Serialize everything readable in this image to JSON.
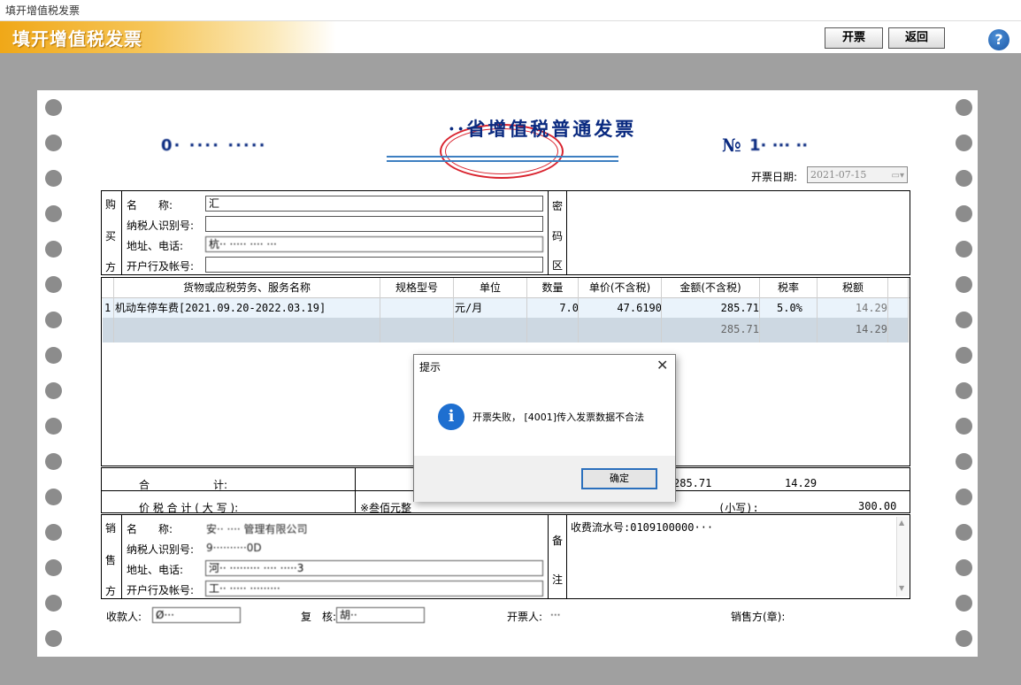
{
  "window": {
    "title": "填开增值税发票"
  },
  "header": {
    "title": "填开增值税发票",
    "issue_button": "开票",
    "back_button": "返回",
    "help_glyph": "?"
  },
  "invoice": {
    "title": "··省增值税普通发票",
    "code": "0· ···· ·····",
    "number_label": "№",
    "number": "1· ··· ··",
    "date_label": "开票日期:",
    "date": "2021-07-15",
    "buyer": {
      "side_label": [
        "购",
        "买",
        "方"
      ],
      "name_label": "名　　称:",
      "name": "汇",
      "taxid_label": "纳税人识别号:",
      "taxid": "",
      "address_label": "地址、电话:",
      "address": "杭·· ····· ···· ···",
      "bank_label": "开户行及帐号:",
      "bank": ""
    },
    "cipher_label": [
      "密",
      "码",
      "区"
    ],
    "columns": [
      "货物或应税劳务、服务名称",
      "规格型号",
      "单位",
      "数量",
      "单价(不含税)",
      "金额(不含税)",
      "税率",
      "税额"
    ],
    "items": [
      {
        "index": "1",
        "name": "机动车停车费[2021.09.20-2022.03.19]",
        "spec": "",
        "unit": "元/月",
        "qty": "7.0",
        "price": "47.6190",
        "amount": "285.71",
        "rate": "5.0%",
        "tax": "14.29"
      }
    ],
    "subtotal_row": {
      "amount": "285.71",
      "tax": "14.29"
    },
    "total_label": "合　　　　　　计:",
    "total_amount": "285.71",
    "total_tax": "14.29",
    "grand_label": "价 税 合 计 ( 大 写 ):",
    "grand_upper": "※叁佰元整",
    "grand_lower_label": "(小写):",
    "grand_lower": "300.00",
    "seller": {
      "side_label": [
        "销",
        "售",
        "方"
      ],
      "name_label": "名　　称:",
      "name": "安·· ···· 管理有限公司",
      "taxid_label": "纳税人识别号:",
      "taxid": "9··········0D",
      "address_label": "地址、电话:",
      "address": "河·· ········· ···· ·····3",
      "bank_label": "开户行及帐号:",
      "bank": "工·· ····· ·········"
    },
    "remark_label": [
      "备",
      "注"
    ],
    "remark": "收费流水号:0109100000···",
    "payee_label": "收款人:",
    "payee": "Ø···",
    "reviewer_label": "复　核:",
    "reviewer": "胡··",
    "drawer_label": "开票人:",
    "drawer": "···",
    "seller_stamp_label": "销售方(章):"
  },
  "dialog": {
    "title": "提示",
    "close_glyph": "✕",
    "message": "开票失败， [4001]传入发票数据不合法",
    "ok_button": "确定",
    "icon_glyph": "i"
  }
}
